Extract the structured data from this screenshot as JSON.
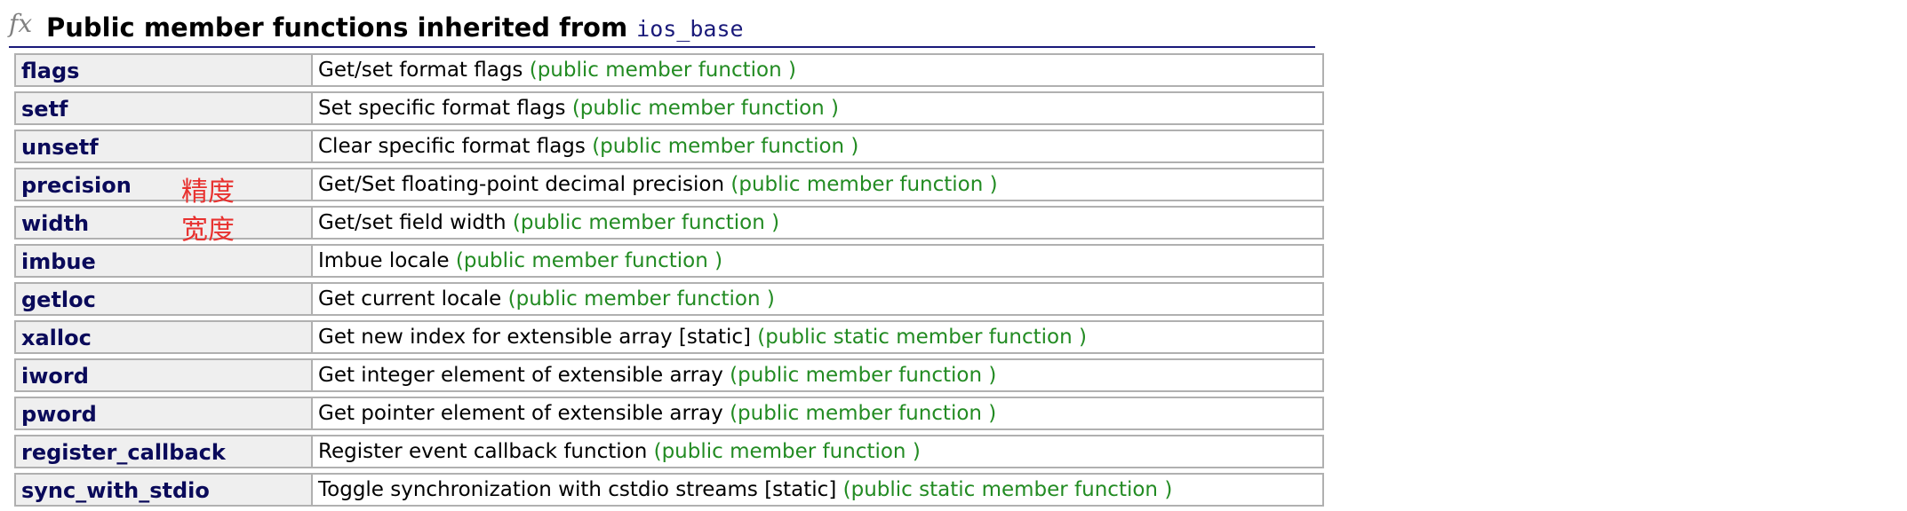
{
  "section": {
    "icon": "fx-function-icon",
    "icon_text": "fx",
    "title": "Public member functions inherited from",
    "class_name": "ios_base"
  },
  "rows": [
    {
      "name": "flags",
      "note": "",
      "description": "Get/set format flags",
      "kind": "(public member function )"
    },
    {
      "name": "setf",
      "note": "",
      "description": "Set specific format flags",
      "kind": "(public member function )"
    },
    {
      "name": "unsetf",
      "note": "",
      "description": "Clear specific format flags",
      "kind": "(public member function )"
    },
    {
      "name": "precision",
      "note": "精度",
      "description": "Get/Set floating-point decimal precision",
      "kind": "(public member function )"
    },
    {
      "name": "width",
      "note": "宽度",
      "description": "Get/set field width",
      "kind": "(public member function )"
    },
    {
      "name": "imbue",
      "note": "",
      "description": "Imbue locale",
      "kind": "(public member function )"
    },
    {
      "name": "getloc",
      "note": "",
      "description": "Get current locale",
      "kind": "(public member function )"
    },
    {
      "name": "xalloc",
      "note": "",
      "description": "Get new index for extensible array [static]",
      "kind": "(public static member function )"
    },
    {
      "name": "iword",
      "note": "",
      "description": "Get integer element of extensible array",
      "kind": "(public member function )"
    },
    {
      "name": "pword",
      "note": "",
      "description": "Get pointer element of extensible array",
      "kind": "(public member function )"
    },
    {
      "name": "register_callback",
      "note": "",
      "description": "Register event callback function",
      "kind": "(public member function )"
    },
    {
      "name": "sync_with_stdio",
      "note": "",
      "description": "Toggle synchronization with cstdio streams [static]",
      "kind": "(public static member function )"
    }
  ],
  "colors": {
    "name_text": "#0a0a5a",
    "kind_text": "#228b22",
    "note_text": "#e8312f",
    "name_cell_bg": "#efefef",
    "border": "#b0b0b0",
    "heading_rule": "#1a1a7a"
  }
}
